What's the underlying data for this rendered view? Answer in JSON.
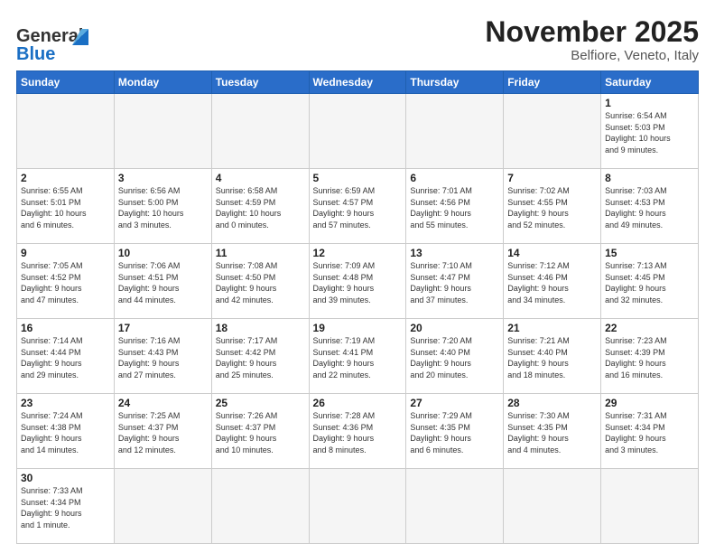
{
  "header": {
    "logo_general": "General",
    "logo_blue": "Blue",
    "month_title": "November 2025",
    "subtitle": "Belfiore, Veneto, Italy"
  },
  "weekdays": [
    "Sunday",
    "Monday",
    "Tuesday",
    "Wednesday",
    "Thursday",
    "Friday",
    "Saturday"
  ],
  "weeks": [
    [
      {
        "day": "",
        "info": ""
      },
      {
        "day": "",
        "info": ""
      },
      {
        "day": "",
        "info": ""
      },
      {
        "day": "",
        "info": ""
      },
      {
        "day": "",
        "info": ""
      },
      {
        "day": "",
        "info": ""
      },
      {
        "day": "1",
        "info": "Sunrise: 6:54 AM\nSunset: 5:03 PM\nDaylight: 10 hours\nand 9 minutes."
      }
    ],
    [
      {
        "day": "2",
        "info": "Sunrise: 6:55 AM\nSunset: 5:01 PM\nDaylight: 10 hours\nand 6 minutes."
      },
      {
        "day": "3",
        "info": "Sunrise: 6:56 AM\nSunset: 5:00 PM\nDaylight: 10 hours\nand 3 minutes."
      },
      {
        "day": "4",
        "info": "Sunrise: 6:58 AM\nSunset: 4:59 PM\nDaylight: 10 hours\nand 0 minutes."
      },
      {
        "day": "5",
        "info": "Sunrise: 6:59 AM\nSunset: 4:57 PM\nDaylight: 9 hours\nand 57 minutes."
      },
      {
        "day": "6",
        "info": "Sunrise: 7:01 AM\nSunset: 4:56 PM\nDaylight: 9 hours\nand 55 minutes."
      },
      {
        "day": "7",
        "info": "Sunrise: 7:02 AM\nSunset: 4:55 PM\nDaylight: 9 hours\nand 52 minutes."
      },
      {
        "day": "8",
        "info": "Sunrise: 7:03 AM\nSunset: 4:53 PM\nDaylight: 9 hours\nand 49 minutes."
      }
    ],
    [
      {
        "day": "9",
        "info": "Sunrise: 7:05 AM\nSunset: 4:52 PM\nDaylight: 9 hours\nand 47 minutes."
      },
      {
        "day": "10",
        "info": "Sunrise: 7:06 AM\nSunset: 4:51 PM\nDaylight: 9 hours\nand 44 minutes."
      },
      {
        "day": "11",
        "info": "Sunrise: 7:08 AM\nSunset: 4:50 PM\nDaylight: 9 hours\nand 42 minutes."
      },
      {
        "day": "12",
        "info": "Sunrise: 7:09 AM\nSunset: 4:48 PM\nDaylight: 9 hours\nand 39 minutes."
      },
      {
        "day": "13",
        "info": "Sunrise: 7:10 AM\nSunset: 4:47 PM\nDaylight: 9 hours\nand 37 minutes."
      },
      {
        "day": "14",
        "info": "Sunrise: 7:12 AM\nSunset: 4:46 PM\nDaylight: 9 hours\nand 34 minutes."
      },
      {
        "day": "15",
        "info": "Sunrise: 7:13 AM\nSunset: 4:45 PM\nDaylight: 9 hours\nand 32 minutes."
      }
    ],
    [
      {
        "day": "16",
        "info": "Sunrise: 7:14 AM\nSunset: 4:44 PM\nDaylight: 9 hours\nand 29 minutes."
      },
      {
        "day": "17",
        "info": "Sunrise: 7:16 AM\nSunset: 4:43 PM\nDaylight: 9 hours\nand 27 minutes."
      },
      {
        "day": "18",
        "info": "Sunrise: 7:17 AM\nSunset: 4:42 PM\nDaylight: 9 hours\nand 25 minutes."
      },
      {
        "day": "19",
        "info": "Sunrise: 7:19 AM\nSunset: 4:41 PM\nDaylight: 9 hours\nand 22 minutes."
      },
      {
        "day": "20",
        "info": "Sunrise: 7:20 AM\nSunset: 4:40 PM\nDaylight: 9 hours\nand 20 minutes."
      },
      {
        "day": "21",
        "info": "Sunrise: 7:21 AM\nSunset: 4:40 PM\nDaylight: 9 hours\nand 18 minutes."
      },
      {
        "day": "22",
        "info": "Sunrise: 7:23 AM\nSunset: 4:39 PM\nDaylight: 9 hours\nand 16 minutes."
      }
    ],
    [
      {
        "day": "23",
        "info": "Sunrise: 7:24 AM\nSunset: 4:38 PM\nDaylight: 9 hours\nand 14 minutes."
      },
      {
        "day": "24",
        "info": "Sunrise: 7:25 AM\nSunset: 4:37 PM\nDaylight: 9 hours\nand 12 minutes."
      },
      {
        "day": "25",
        "info": "Sunrise: 7:26 AM\nSunset: 4:37 PM\nDaylight: 9 hours\nand 10 minutes."
      },
      {
        "day": "26",
        "info": "Sunrise: 7:28 AM\nSunset: 4:36 PM\nDaylight: 9 hours\nand 8 minutes."
      },
      {
        "day": "27",
        "info": "Sunrise: 7:29 AM\nSunset: 4:35 PM\nDaylight: 9 hours\nand 6 minutes."
      },
      {
        "day": "28",
        "info": "Sunrise: 7:30 AM\nSunset: 4:35 PM\nDaylight: 9 hours\nand 4 minutes."
      },
      {
        "day": "29",
        "info": "Sunrise: 7:31 AM\nSunset: 4:34 PM\nDaylight: 9 hours\nand 3 minutes."
      }
    ],
    [
      {
        "day": "30",
        "info": "Sunrise: 7:33 AM\nSunset: 4:34 PM\nDaylight: 9 hours\nand 1 minute."
      },
      {
        "day": "",
        "info": ""
      },
      {
        "day": "",
        "info": ""
      },
      {
        "day": "",
        "info": ""
      },
      {
        "day": "",
        "info": ""
      },
      {
        "day": "",
        "info": ""
      },
      {
        "day": "",
        "info": ""
      }
    ]
  ]
}
